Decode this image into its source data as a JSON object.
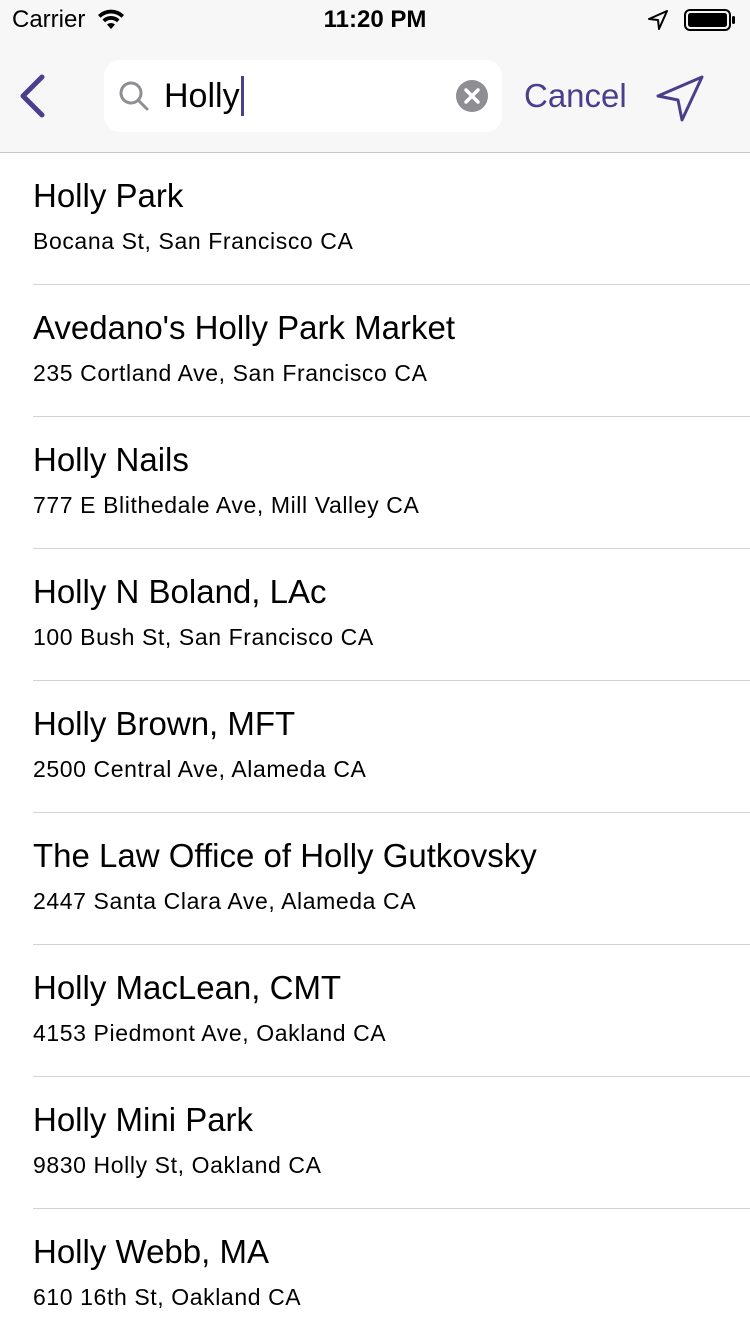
{
  "status_bar": {
    "carrier": "Carrier",
    "time": "11:20 PM",
    "icons": [
      "wifi-icon",
      "location-arrow-icon",
      "battery-icon"
    ]
  },
  "nav": {
    "back_icon": "chevron-left-icon",
    "search": {
      "value": "Holly",
      "icon": "search-icon",
      "clear_icon": "clear-icon"
    },
    "cancel_label": "Cancel",
    "send_icon": "send-location-icon"
  },
  "colors": {
    "accent": "#4b3f8c",
    "bar_background": "#f7f7f7",
    "separator": "#d1d1d6"
  },
  "results": [
    {
      "name": "Holly Park",
      "address": "Bocana St, San Francisco CA"
    },
    {
      "name": "Avedano's Holly Park Market",
      "address": "235 Cortland Ave, San Francisco CA"
    },
    {
      "name": "Holly Nails",
      "address": "777 E Blithedale Ave, Mill Valley CA"
    },
    {
      "name": "Holly N Boland, LAc",
      "address": "100 Bush St, San Francisco CA"
    },
    {
      "name": "Holly Brown, MFT",
      "address": "2500 Central Ave, Alameda CA"
    },
    {
      "name": "The Law Office of Holly Gutkovsky",
      "address": "2447 Santa Clara Ave, Alameda CA"
    },
    {
      "name": "Holly MacLean, CMT",
      "address": "4153 Piedmont Ave, Oakland CA"
    },
    {
      "name": "Holly Mini Park",
      "address": "9830 Holly St, Oakland CA"
    },
    {
      "name": "Holly Webb, MA",
      "address": "610 16th St, Oakland CA"
    }
  ]
}
